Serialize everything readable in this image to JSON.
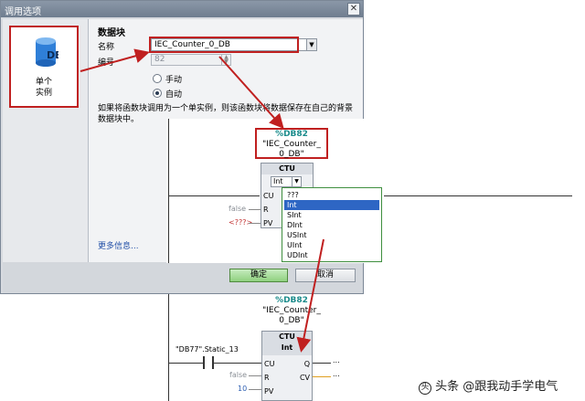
{
  "dialog": {
    "title": "调用选项",
    "close_icon": "close-icon",
    "left_tile": {
      "icon_label": "DB",
      "line1": "单个",
      "line2": "实例"
    },
    "section_title": "数据块",
    "name_label": "名称",
    "name_value": "IEC_Counter_0_DB",
    "number_label": "编号",
    "number_value": "82",
    "radio_manual": "手动",
    "radio_auto": "自动",
    "selected_mode": "自动",
    "description": "如果将函数块调用为一个单实例，则该函数块将数据保存在自己的背景数据块中。",
    "more_info": "更多信息...",
    "ok": "确定",
    "cancel": "取消"
  },
  "network_top": {
    "db_ref_num": "%DB82",
    "db_ref_name1": "\"IEC_Counter_",
    "db_ref_name2": "0_DB\"",
    "block_name": "CTU",
    "type_selected": "Int",
    "pins": {
      "cu": "CU",
      "r": "R",
      "pv": "PV"
    },
    "r_value": "false",
    "pv_value": "<???>",
    "type_options": [
      "???",
      "Int",
      "SInt",
      "DInt",
      "USInt",
      "UInt",
      "UDInt"
    ],
    "highlighted_option": "Int"
  },
  "network_bottom": {
    "db_ref_num": "%DB82",
    "db_ref_name1": "\"IEC_Counter_",
    "db_ref_name2": "0_DB\"",
    "block_name": "CTU",
    "block_type": "Int",
    "contact_tag": "\"DB77\".Static_13",
    "pins": {
      "cu": "CU",
      "r": "R",
      "pv": "PV",
      "q": "Q",
      "cv": "CV"
    },
    "r_value": "false",
    "pv_value": "10",
    "q_value": "...",
    "cv_value": "..."
  },
  "watermark": {
    "logo": "头",
    "text": "头条 @跟我动手学电气"
  },
  "colors": {
    "highlight_red": "#c02020",
    "accent_teal": "#1c8c8c",
    "selection_blue": "#2e66c4",
    "ok_green": "#8fd07f"
  }
}
